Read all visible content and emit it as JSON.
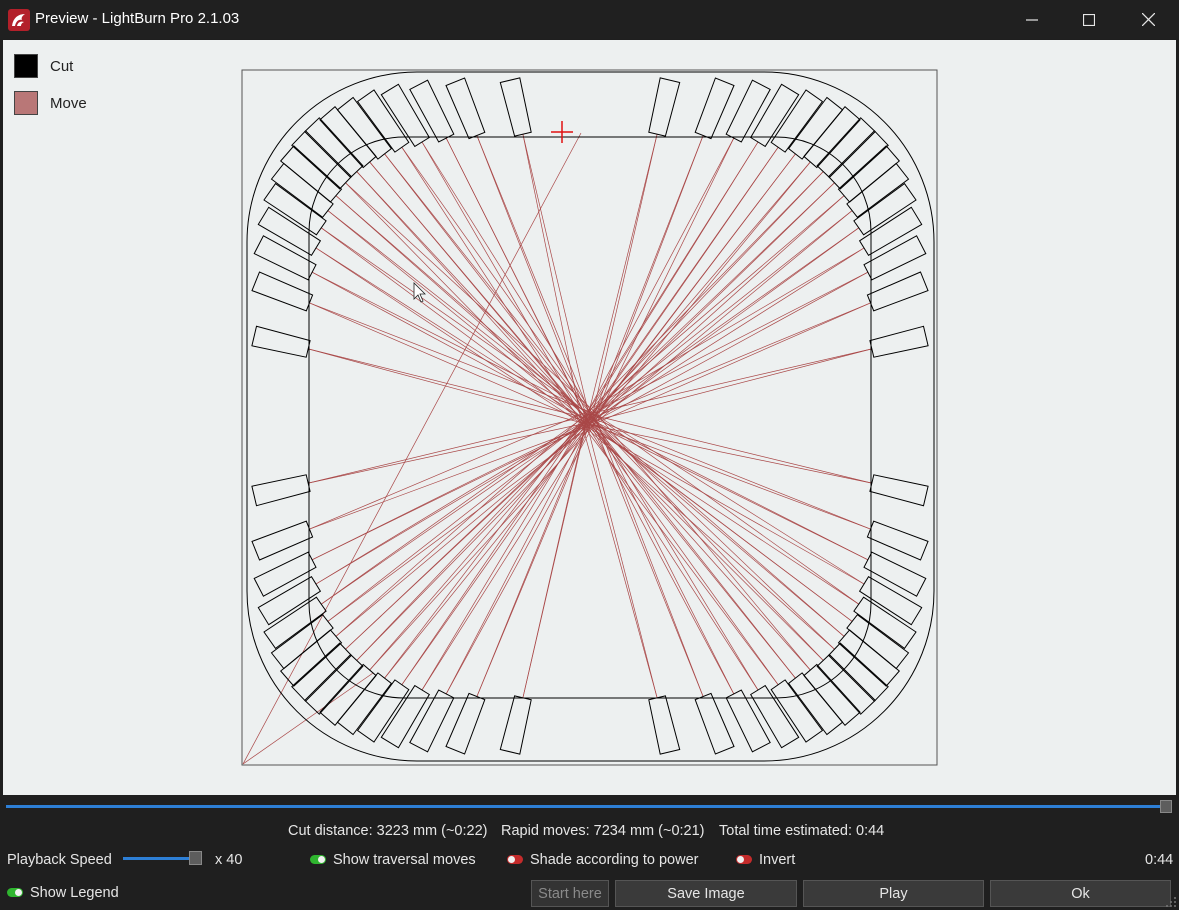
{
  "window": {
    "title": "Preview - LightBurn Pro 2.1.03",
    "controls": [
      "minimize-icon",
      "maximize-icon",
      "close-icon"
    ]
  },
  "legend": [
    {
      "label": "Cut",
      "color": "#000000"
    },
    {
      "label": "Move",
      "color": "#b97777"
    }
  ],
  "playback": {
    "progress": 1.0
  },
  "stats": {
    "cut_distance": "Cut distance: 3223 mm (~0:22)",
    "rapid_moves": "Rapid moves: 7234 mm (~0:21)",
    "total_time": "Total time estimated: 0:44"
  },
  "controls": {
    "playback_speed_label": "Playback Speed",
    "playback_speed_value": "x 40",
    "playback_speed_fraction": 1.0,
    "show_traversal_label": "Show traversal moves",
    "show_traversal_on": true,
    "shade_power_label": "Shade according to power",
    "shade_power_on": false,
    "invert_label": "Invert",
    "invert_on": false,
    "elapsed": "0:44",
    "show_legend_label": "Show Legend",
    "show_legend_on": true
  },
  "buttons": {
    "start_here": "Start here",
    "save_image": "Save Image",
    "play": "Play",
    "ok": "Ok"
  },
  "colors": {
    "cut": "#000000",
    "move": "#9e2b2b",
    "marker": "#e01010",
    "accent": "#2d7fd6"
  }
}
